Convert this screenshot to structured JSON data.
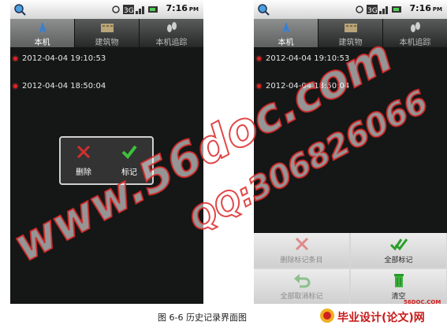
{
  "status_bar": {
    "time": "7:16",
    "time_suffix": "PM",
    "network_label": "3G"
  },
  "tabs": [
    {
      "label": "本机",
      "icon": "compass-arrow-icon"
    },
    {
      "label": "建筑物",
      "icon": "building-icon"
    },
    {
      "label": "本机追踪",
      "icon": "footprints-icon"
    }
  ],
  "history": [
    "2012-04-04 19:10:53",
    "2012-04-04 18:50:04"
  ],
  "popup": {
    "delete_label": "删除",
    "mark_label": "标记"
  },
  "options_menu": {
    "delete_marked": "删除标记条目",
    "mark_all": "全部标记",
    "unmark_all": "全部取消标记",
    "clear": "清空"
  },
  "caption": "图 6-6  历史记录界面图",
  "watermarks": [
    "www.56doc.com",
    "QQ:306826066"
  ],
  "site_logo": {
    "small_text": "56DOC.COM",
    "text": "毕业设计(论文)网"
  },
  "colors": {
    "accent_red": "#e02020",
    "check_green": "#3cc23c",
    "mark_delete_red": "#d03030"
  }
}
